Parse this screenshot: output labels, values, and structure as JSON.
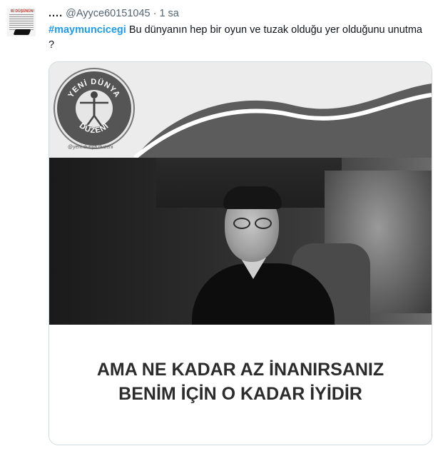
{
  "tweet": {
    "display_name": "....",
    "handle": "@Ayyce60151045",
    "separator": "·",
    "time": "1 sa",
    "hashtag": "#maymuncicegi",
    "text": " Bu dünyanın hep bir oyun ve tuzak olduğu yer olduğunu unutma ?",
    "avatar_text": "Bİ DÜŞÜNÜN!"
  },
  "media": {
    "logo_top": "YENİ DÜNYA",
    "logo_bottom": "DÜZENİ",
    "logo_caption": "@yeni.dunya.duzeni",
    "caption_line1": "AMA NE KADAR AZ İNANIRSANIZ",
    "caption_line2": "BENİM İÇİN O KADAR İYİDİR"
  }
}
